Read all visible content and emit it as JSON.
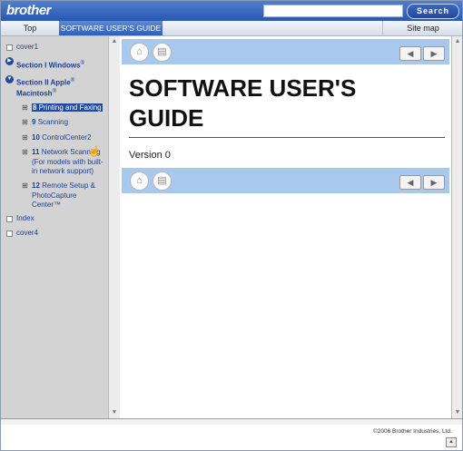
{
  "header": {
    "logo": "brother",
    "search_placeholder": "",
    "search_label": "Search"
  },
  "nav": {
    "top": "Top",
    "guide": "SOFTWARE USER'S GUIDE",
    "sitemap": "Site map"
  },
  "sidebar": {
    "cover1": "cover1",
    "section1": "Section I Windows",
    "section1_sup": "®",
    "section2_line1": "Section II Apple",
    "section2_sup": "®",
    "section2_line2": "Macintosh",
    "section2_sup2": "®",
    "items": [
      {
        "num": "8",
        "label": "Printing and Faxing"
      },
      {
        "num": "9",
        "label": "Scanning"
      },
      {
        "num": "10",
        "label": "ControlCenter2"
      },
      {
        "num": "11",
        "label": "Network Scanning"
      },
      {
        "num": "12",
        "label": "Remote Setup &"
      }
    ],
    "item11_line2": "(For models with built-",
    "item11_line3": "in network support)",
    "item12_line2": "PhotoCapture",
    "item12_line3": "Center™",
    "index": "Index",
    "cover4": "cover4"
  },
  "content": {
    "title_line1": "SOFTWARE USER'S",
    "title_line2": "GUIDE",
    "version": "Version 0"
  },
  "footer": {
    "copyright": "©2006 Brother Industries, Ltd."
  },
  "colors": {
    "brand_blue": "#2858b0",
    "content_bar": "#a8c8ee",
    "sidebar_bg": "#d3d3d3"
  },
  "icons": [
    "home-icon",
    "print-icon",
    "prev-arrow-icon",
    "next-arrow-icon",
    "hand-cursor-icon"
  ]
}
